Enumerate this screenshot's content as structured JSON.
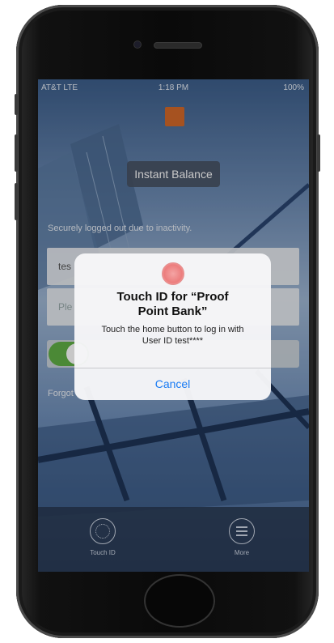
{
  "status_bar": {
    "carrier": "AT&T  LTE",
    "time": "1:18 PM",
    "battery": "100%"
  },
  "login": {
    "instant_balance": "Instant Balance",
    "logout_message": "Securely logged out due to inactivity.",
    "user_id_value": "tes",
    "password_placeholder": "Ple",
    "forgot_link": "Forgot"
  },
  "alert": {
    "title_line1": "Touch ID for “Proof",
    "title_line2": "Point Bank”",
    "message_line1": "Touch the home button to log in with",
    "message_line2": "User ID test****",
    "cancel_label": "Cancel"
  },
  "tabbar": {
    "touch_id_label": "Touch ID",
    "more_label": "More"
  },
  "colors": {
    "logo": "#d56a2a",
    "toggle_on": "#61b046",
    "ios_blue": "#1a7cf4"
  }
}
